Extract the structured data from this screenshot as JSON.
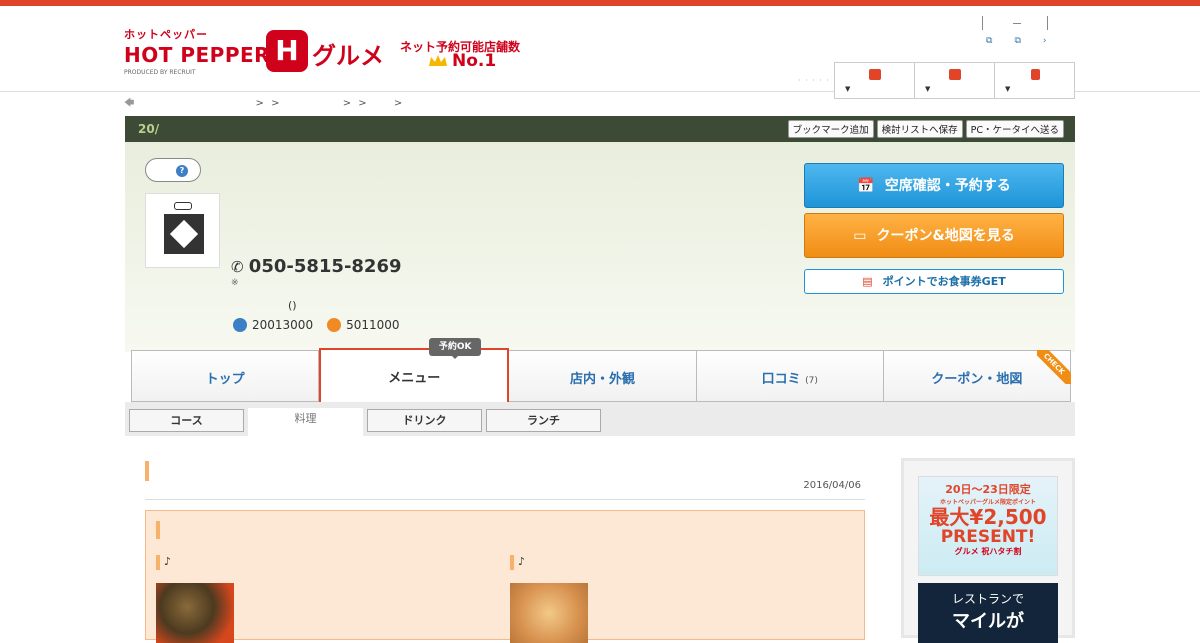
{
  "header": {
    "logo_kana": "ホットペッパー",
    "logo_main": "HOT PEPPER",
    "logo_sub": "PRODUCED BY RECRUIT",
    "logo_h": "H",
    "logo_gurume": "グルメ",
    "tagline": "ネット予約可能店舗数",
    "rank": "No.1",
    "dots": "· · · · · ·",
    "link_arrow": "›",
    "brand_color": "#d0021b"
  },
  "breadcrumb": {
    "items": [
      ">",
      ">",
      ">",
      ">",
      ">"
    ]
  },
  "shopbar": {
    "count": "20/",
    "buttons": [
      "ブックマーク追加",
      "検討リストへ保存",
      "PC・ケータイへ送る"
    ]
  },
  "shop": {
    "help": "?",
    "tel": "050-5815-8269",
    "tel_note": "※",
    "paren": "()",
    "dinner": "20013000",
    "lunch": "5011000",
    "reserve_button": "空席確認・予約する",
    "coupon_button": "クーポン&地図を見る",
    "point_button": "ポイントでお食事券GET"
  },
  "tabs": [
    {
      "label": "トップ",
      "count": ""
    },
    {
      "label": "メニュー",
      "count": ""
    },
    {
      "label": "店内・外観",
      "count": ""
    },
    {
      "label": "口コミ",
      "count": "(7)"
    },
    {
      "label": "クーポン・地図",
      "count": ""
    }
  ],
  "tab_badge": "予約OK",
  "tab_check": "CHECK",
  "subnav": [
    "コース",
    "料理",
    "ドリンク",
    "ランチ"
  ],
  "content": {
    "date": "2016/04/06",
    "note1": "♪",
    "note2": "♪"
  },
  "side_ad": {
    "line1": "20日〜23日限定",
    "line2": "ホットペッパーグルメ限定ポイント",
    "line3": "最大¥2,500",
    "line4": "PRESENT!",
    "line5": "グルメ 祝ハタチ割",
    "ad2_line1": "レストランで",
    "ad2_line2": "マイルが"
  },
  "accent": "#e0452a"
}
